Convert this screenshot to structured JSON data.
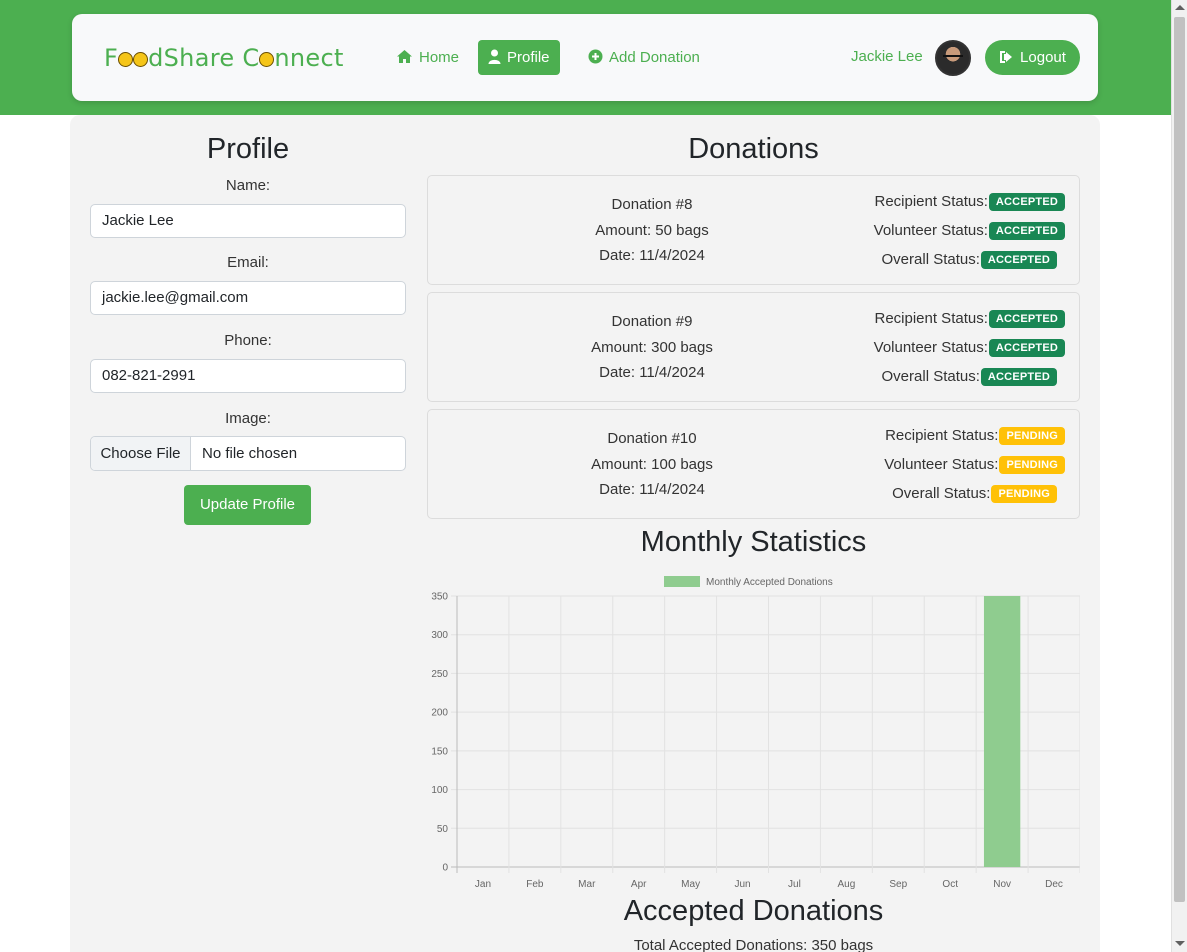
{
  "navbar": {
    "brand": {
      "prefix": "F",
      "middle": "dShare C",
      "suffix": "nnect"
    },
    "links": [
      {
        "label": "Home",
        "icon": "home-icon"
      },
      {
        "label": "Profile",
        "icon": "user-icon",
        "active": true
      },
      {
        "label": "Add Donation",
        "icon": "plus-circle-icon"
      }
    ],
    "user_name": "Jackie Lee",
    "logout_label": "Logout"
  },
  "profile": {
    "title": "Profile",
    "name_label": "Name:",
    "name_value": "Jackie Lee",
    "email_label": "Email:",
    "email_value": "jackie.lee@gmail.com",
    "phone_label": "Phone:",
    "phone_value": "082-821-2991",
    "image_label": "Image:",
    "choose_file_label": "Choose File",
    "no_file_label": "No file chosen",
    "update_label": "Update Profile"
  },
  "donations": {
    "title": "Donations",
    "status_labels": {
      "recipient": "Recipient Status:",
      "volunteer": "Volunteer Status:",
      "overall": "Overall Status:"
    },
    "items": [
      {
        "title": "Donation #8",
        "amount": "Amount: 50 bags",
        "date": "Date: 11/4/2024",
        "recipient": "ACCEPTED",
        "volunteer": "ACCEPTED",
        "overall": "ACCEPTED"
      },
      {
        "title": "Donation #9",
        "amount": "Amount: 300 bags",
        "date": "Date: 11/4/2024",
        "recipient": "ACCEPTED",
        "volunteer": "ACCEPTED",
        "overall": "ACCEPTED"
      },
      {
        "title": "Donation #10",
        "amount": "Amount: 100 bags",
        "date": "Date: 11/4/2024",
        "recipient": "PENDING",
        "volunteer": "PENDING",
        "overall": "PENDING"
      }
    ]
  },
  "stats": {
    "title": "Monthly Statistics",
    "accepted_title": "Accepted Donations",
    "accepted_total": "Total Accepted Donations: 350 bags"
  },
  "colors": {
    "brand": "#4CAF50",
    "accepted": "#198754",
    "pending": "#ffc107",
    "bar": "#8fcc8f"
  },
  "chart_data": {
    "type": "bar",
    "categories": [
      "Jan",
      "Feb",
      "Mar",
      "Apr",
      "May",
      "Jun",
      "Jul",
      "Aug",
      "Sep",
      "Oct",
      "Nov",
      "Dec"
    ],
    "series": [
      {
        "name": "Monthly Accepted Donations",
        "values": [
          0,
          0,
          0,
          0,
          0,
          0,
          0,
          0,
          0,
          0,
          350,
          0
        ]
      }
    ],
    "yticks": [
      0,
      50,
      100,
      150,
      200,
      250,
      300,
      350
    ],
    "ylim": [
      0,
      350
    ],
    "grid": true,
    "legend": "top"
  }
}
